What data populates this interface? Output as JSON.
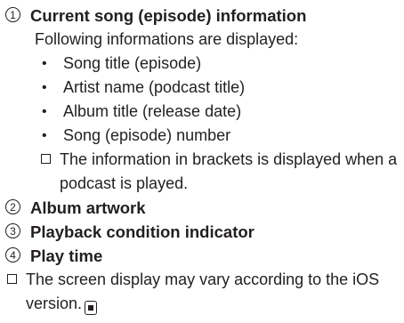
{
  "items": [
    {
      "num": "1",
      "title": "Current song (episode) information"
    },
    {
      "num": "2",
      "title": "Album artwork"
    },
    {
      "num": "3",
      "title": "Playback condition indicator"
    },
    {
      "num": "4",
      "title": "Play time"
    }
  ],
  "intro": "Following informations are displayed:",
  "bullets": [
    "Song title (episode)",
    "Artist name (podcast title)",
    "Album title (release date)",
    "Song (episode) number"
  ],
  "bullet_glyph": "•",
  "note_brackets": "The information in brackets is displayed when a podcast is played.",
  "note_screen": "The screen display may vary according to the iOS version.",
  "icons": {
    "note_box": "note-checkbox-icon",
    "end_mark": "end-of-section-icon"
  },
  "colors": {
    "text": "#231f20",
    "background": "#ffffff"
  }
}
